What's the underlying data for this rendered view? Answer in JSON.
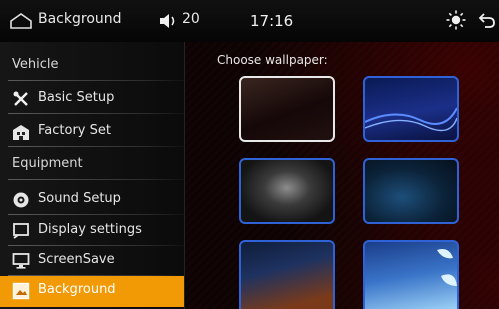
{
  "statusbar": {
    "title": "Background",
    "volume": "20",
    "time": "17:16"
  },
  "sidebar": {
    "sections": [
      {
        "type": "header",
        "label": "Vehicle"
      },
      {
        "type": "item",
        "label": "Basic Setup",
        "icon": "tools-icon"
      },
      {
        "type": "item",
        "label": "Factory Set",
        "icon": "factory-icon"
      },
      {
        "type": "header",
        "label": "Equipment"
      },
      {
        "type": "item",
        "label": "Sound Setup",
        "icon": "sound-icon"
      },
      {
        "type": "item",
        "label": "Display settings",
        "icon": "display-icon"
      },
      {
        "type": "item",
        "label": "ScreenSave",
        "icon": "monitor-icon"
      },
      {
        "type": "item",
        "label": "Background",
        "icon": "picture-icon",
        "active": true
      }
    ],
    "active_color": "#f29a06"
  },
  "main": {
    "heading": "Choose wallpaper:",
    "selected_index": 0
  },
  "colors": {
    "tile_border": "#2f62d6",
    "tile_selected_border": "#e8e8e8"
  }
}
